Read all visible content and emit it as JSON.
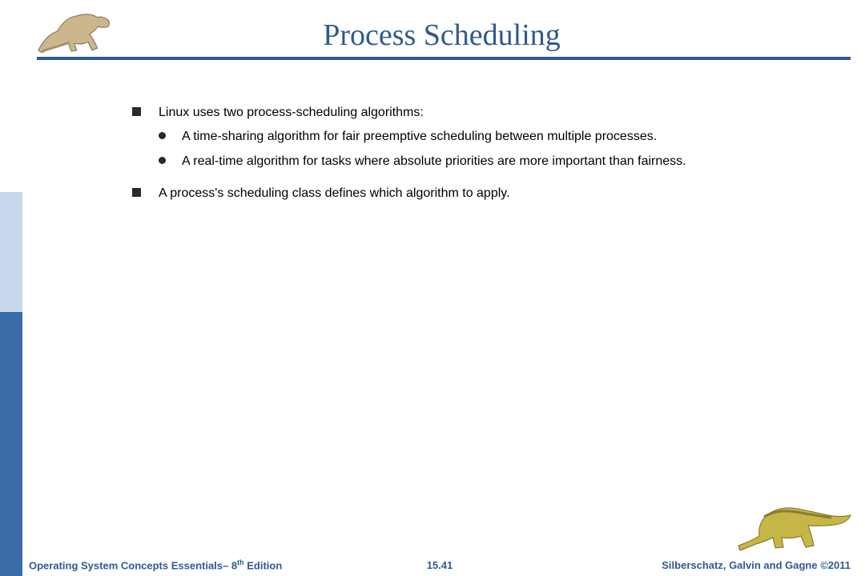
{
  "title": "Process Scheduling",
  "bullets": {
    "b1": "Linux uses two process-scheduling algorithms:",
    "b1a": "A time-sharing algorithm for fair preemptive scheduling between multiple processes.",
    "b1b": "A real-time algorithm for tasks where absolute priorities are more important than fairness.",
    "b2": "A process's scheduling class defines which algorithm to apply."
  },
  "footer": {
    "left_pre": "Operating System Concepts Essentials– 8",
    "left_sup": "th",
    "left_post": " Edition",
    "center": "15.41",
    "right": "Silberschatz, Galvin and Gagne ©2011"
  }
}
